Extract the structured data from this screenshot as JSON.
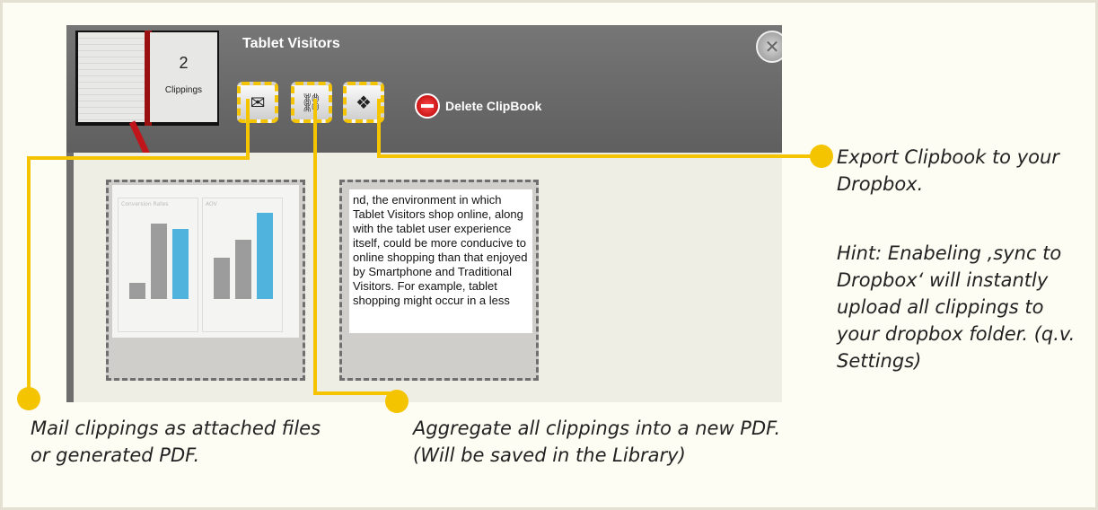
{
  "app": {
    "clipbook_title": "Tablet Visitors",
    "clipping_count": "2",
    "clipping_label": "Clippings",
    "close_icon": "close-icon",
    "delete_label": "Delete ClipBook",
    "toolbar": {
      "mail_icon": "mail-export-icon",
      "pdf_icon": "aggregate-pdf-icon",
      "dropbox_icon": "dropbox-icon"
    },
    "cards": [
      {
        "type": "chart-thumbnail",
        "chart_title_left": "Conversion Rates",
        "chart_title_right": "AOV"
      },
      {
        "type": "text-excerpt",
        "text": "nd, the environment in which Tablet Visitors shop online, along with the tablet user experience itself, could be more conducive to online shopping than that enjoyed by Smartphone and Traditional Visitors. For example, tablet shopping might occur in a less"
      }
    ]
  },
  "annotations": {
    "mail": "Mail clippings as attached files or generated PDF.",
    "aggregate": "Aggregate all clippings into a new PDF. (Will be saved in the Library)",
    "export": "Export Clipbook to your Dropbox.",
    "hint": "Hint: Enabeling ‚sync to Dropbox‘ will instantly upload all clippings to your dropbox folder. (q.v. Settings)"
  },
  "colors": {
    "accent": "#f5c400",
    "background": "#fdfdf3",
    "app_dark": "#6e6e6e"
  }
}
